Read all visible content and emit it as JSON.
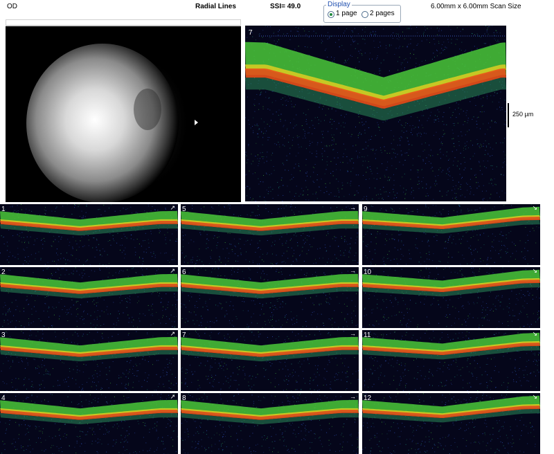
{
  "header": {
    "eye": "OD",
    "scan_type": "Radial Lines",
    "ssi": "SSI= 49.0",
    "display_legend": "Display",
    "display_options": [
      "1 page",
      "2 pages"
    ],
    "display_selected": "1 page",
    "scan_size": "6.00mm x 6.00mm Scan Size"
  },
  "main_scan": {
    "number": "7",
    "scale_label": "250 µm"
  },
  "thumbnails": [
    {
      "number": "1"
    },
    {
      "number": "5"
    },
    {
      "number": "9"
    },
    {
      "number": "2"
    },
    {
      "number": "6"
    },
    {
      "number": "10"
    },
    {
      "number": "3"
    },
    {
      "number": "7"
    },
    {
      "number": "11"
    },
    {
      "number": "4"
    },
    {
      "number": "8"
    },
    {
      "number": "12"
    }
  ],
  "colors": {
    "background_scan": "#05061a",
    "rpe": "#e8501a",
    "retina": "#4ac83a",
    "speckle": "#2a4aa8"
  }
}
